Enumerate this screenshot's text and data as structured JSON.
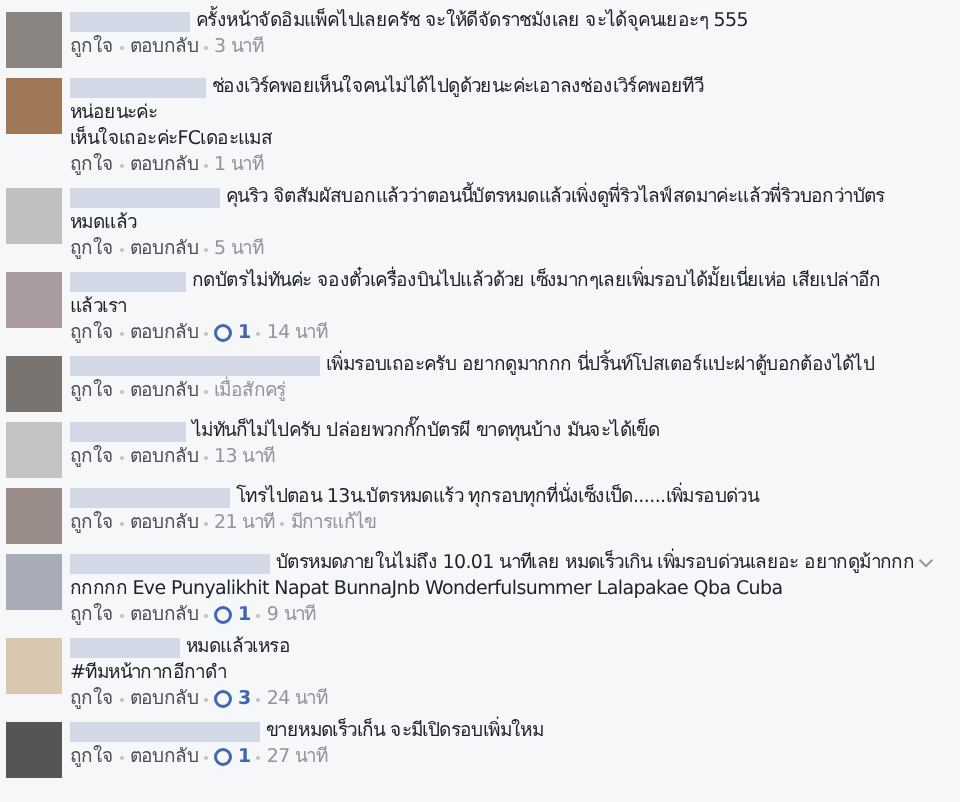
{
  "comments": [
    {
      "color": "#8a8480",
      "lines": [
        "ครั้งหน้าจัดอิมแพ็คไปเลยครัช จะให้ดีจัดราชมังเลย จะได้จุคนเยอะๆ 555"
      ],
      "like_label": "ถูกใจ",
      "reply_label": "ตอบกลับ",
      "time": "3 นาที"
    },
    {
      "color": "#a07858",
      "lines": [
        "ช่องเวิร์คพอยเห็นใจคนไม่ได้ไปดูด้วยนะค่ะเอาลงช่องเวิร์คพอยทีวี",
        "หน่อยนะค่ะ",
        "เห็นใจเถอะค่ะFCเดอะแมส"
      ],
      "like_label": "ถูกใจ",
      "reply_label": "ตอบกลับ",
      "time": "1 นาที"
    },
    {
      "color": "#c0c0c0",
      "lines": [
        "คุนริว จิตสัมผัสบอกแล้วว่าตอนนี้บัตรหมดแล้วเพิ่งดูพี่ริวไลฟ์สดมาค่ะแล้วพี่ริวบอกว่าบัตร",
        "หมดแล้ว"
      ],
      "like_label": "ถูกใจ",
      "reply_label": "ตอบกลับ",
      "time": "5 นาที"
    },
    {
      "color": "#a89aa0",
      "lines": [
        "กดบัตรไม่ทันค่ะ จองตั๋วเครื่องบินไปแล้วด้วย เซ็งมากๆเลยเพิ่มรอบได้มั้ยเนี่ยเห่อ เสียเปล่าอีก",
        "แล้วเรา"
      ],
      "like_label": "ถูกใจ",
      "reply_label": "ตอบกลับ",
      "reactions": "1",
      "time": "14 นาที"
    },
    {
      "color": "#7a7470",
      "lines": [
        "เพิ่มรอบเถอะครับ อยากดูมากกก นี่ปริ้นท์โปสเตอร์แปะฝาตู้บอกต้องได้ไป"
      ],
      "like_label": "ถูกใจ",
      "reply_label": "ตอบกลับ",
      "time": "เมื่อสักครู่"
    },
    {
      "color": "#c4c4c4",
      "lines": [
        "ไม่ทันก็ไม่ไปครับ ปล่อยพวกกั๊กบัตรผี ขาดทุนบ้าง มันจะได้เข็ด"
      ],
      "like_label": "ถูกใจ",
      "reply_label": "ตอบกลับ",
      "time": "13 นาที"
    },
    {
      "color": "#9a8c88",
      "lines": [
        "โทรไปตอน 13น.บัตรหมดแร้ว ทุกรอบทุกที่นั่งเซ็งเป็ด......เพิ่มรอบด่วน"
      ],
      "like_label": "ถูกใจ",
      "reply_label": "ตอบกลับ",
      "time": "21 นาที",
      "edited": "มีการแก้ไข"
    },
    {
      "color": "#a8acb8",
      "lines": [
        "บัตรหมดภายในไม่ถึง 10.01 นาทีเลย หมดเร็วเกิน เพิ่มรอบด่วนเลยอะ อยากดูม้ากกก",
        "กกกกก Eve Punyalikhit Napat BunnaJnb Wonderfulsummer Lalapakae Qba Cuba"
      ],
      "menu": true,
      "like_label": "ถูกใจ",
      "reply_label": "ตอบกลับ",
      "reactions": "1",
      "time": "9 นาที"
    },
    {
      "color": "#d8c8b0",
      "lines": [
        "หมดแล้วเหรอ",
        "#ทีมหน้ากากอีกาดำ"
      ],
      "like_label": "ถูกใจ",
      "reply_label": "ตอบกลับ",
      "reactions": "3",
      "time": "24 นาที"
    },
    {
      "color": "#555555",
      "lines": [
        "ขายหมดเร็วเก็น จะมีเปิดรอบเพิ่มใหม"
      ],
      "like_label": "ถูกใจ",
      "reply_label": "ตอบกลับ",
      "reactions": "1",
      "time": "27 นาที"
    }
  ]
}
